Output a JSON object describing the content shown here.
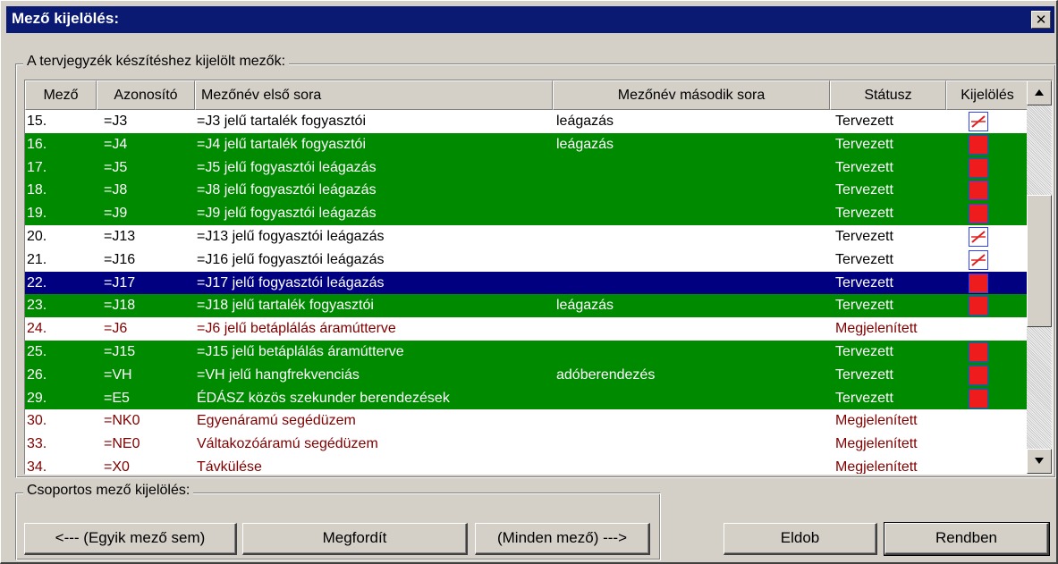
{
  "dialog": {
    "title": "Mező kijelölés:",
    "close_glyph": "✕"
  },
  "fields_group": {
    "label": "A tervjegyzék készítéshez kijelölt mezők:"
  },
  "table": {
    "columns": [
      "Mező",
      "Azonosító",
      "Mezőnév első sora",
      "Mezőnév második sora",
      "Státusz",
      "Kijelölés"
    ],
    "rows": [
      {
        "field": "15.",
        "id": "=J3",
        "name1": "=J3 jelű tartalék fogyasztói",
        "name2": "leágazás",
        "status": "Tervezett",
        "style": "white",
        "mark": "off"
      },
      {
        "field": "16.",
        "id": "=J4",
        "name1": "=J4 jelű tartalék fogyasztói",
        "name2": "leágazás",
        "status": "Tervezett",
        "style": "green",
        "mark": "on"
      },
      {
        "field": "17.",
        "id": "=J5",
        "name1": "=J5 jelű fogyasztói leágazás",
        "name2": "",
        "status": "Tervezett",
        "style": "green",
        "mark": "on"
      },
      {
        "field": "18.",
        "id": "=J8",
        "name1": "=J8 jelű fogyasztói leágazás",
        "name2": "",
        "status": "Tervezett",
        "style": "green",
        "mark": "on"
      },
      {
        "field": "19.",
        "id": "=J9",
        "name1": "=J9 jelű fogyasztói leágazás",
        "name2": "",
        "status": "Tervezett",
        "style": "green",
        "mark": "on"
      },
      {
        "field": "20.",
        "id": "=J13",
        "name1": "=J13 jelű fogyasztói leágazás",
        "name2": "",
        "status": "Tervezett",
        "style": "white",
        "mark": "off"
      },
      {
        "field": "21.",
        "id": "=J16",
        "name1": "=J16 jelű fogyasztói leágazás",
        "name2": "",
        "status": "Tervezett",
        "style": "white",
        "mark": "off"
      },
      {
        "field": "22.",
        "id": "=J17",
        "name1": "=J17 jelű fogyasztói leágazás",
        "name2": "",
        "status": "Tervezett",
        "style": "selected",
        "mark": "on"
      },
      {
        "field": "23.",
        "id": "=J18",
        "name1": "=J18 jelű tartalék fogyasztói",
        "name2": "leágazás",
        "status": "Tervezett",
        "style": "green",
        "mark": "on"
      },
      {
        "field": "24.",
        "id": "=J6",
        "name1": "=J6 jelű betáplálás áramútterve",
        "name2": "",
        "status": "Megjelenített",
        "style": "shown",
        "mark": "none"
      },
      {
        "field": "25.",
        "id": "=J15",
        "name1": "=J15 jelű betáplálás áramútterve",
        "name2": "",
        "status": "Tervezett",
        "style": "green",
        "mark": "on"
      },
      {
        "field": "26.",
        "id": "=VH",
        "name1": "=VH jelű hangfrekvenciás",
        "name2": "adóberendezés",
        "status": "Tervezett",
        "style": "green",
        "mark": "on"
      },
      {
        "field": "29.",
        "id": "=E5",
        "name1": "ÉDÁSZ közös szekunder berendezések",
        "name2": "",
        "status": "Tervezett",
        "style": "green",
        "mark": "on"
      },
      {
        "field": "30.",
        "id": "=NK0",
        "name1": "Egyenáramú segédüzem",
        "name2": "",
        "status": "Megjelenített",
        "style": "shown",
        "mark": "none"
      },
      {
        "field": "33.",
        "id": "=NE0",
        "name1": "Váltakozóáramú segédüzem",
        "name2": "",
        "status": "Megjelenített",
        "style": "shown",
        "mark": "none"
      },
      {
        "field": "34.",
        "id": "=X0",
        "name1": "Távkülése",
        "name2": "",
        "status": "Megjelenített",
        "style": "shown",
        "mark": "none"
      }
    ]
  },
  "group_select": {
    "label": "Csoportos mező kijelölés:",
    "none_label": "<--- (Egyik mező sem)",
    "invert_label": "Megfordít",
    "all_label": "(Minden mező) --->"
  },
  "footer": {
    "discard_label": "Eldob",
    "ok_label": "Rendben"
  },
  "colors": {
    "title_bar": "#0a1a73",
    "selected_row": "#000080",
    "marked_row": "#008a00",
    "shown_text": "#800000",
    "mark_fill": "#ee1c1c"
  }
}
